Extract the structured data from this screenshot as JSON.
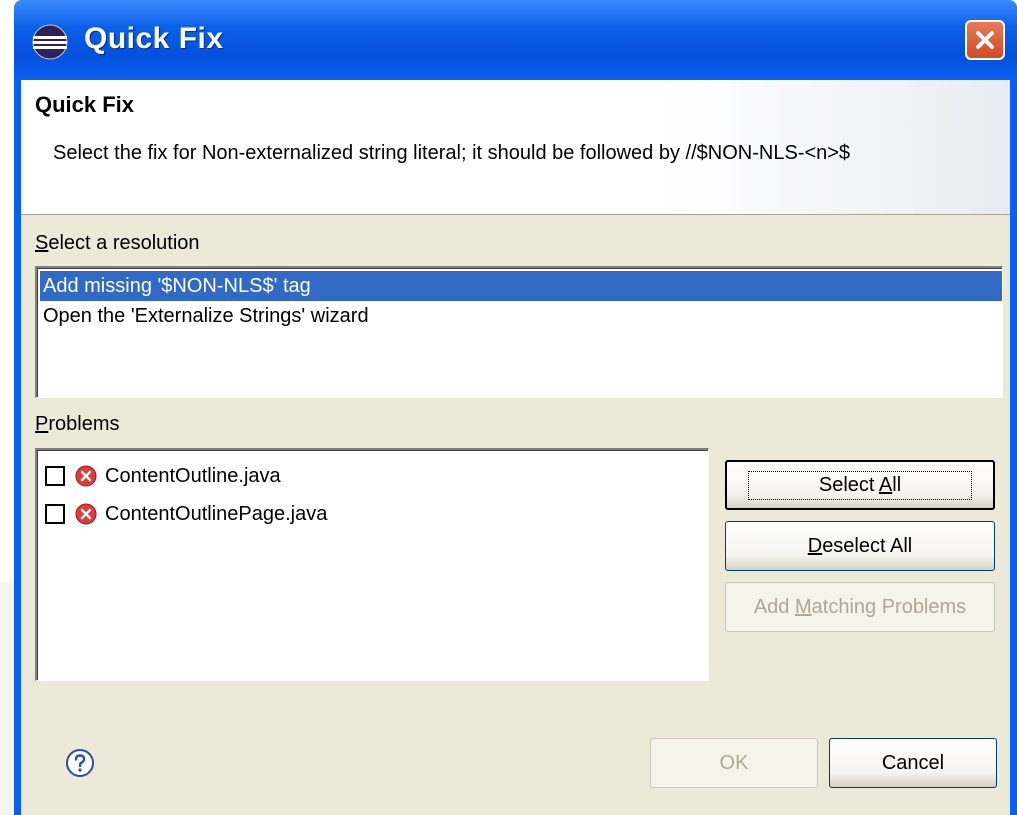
{
  "window": {
    "title": "Quick Fix"
  },
  "header": {
    "title": "Quick Fix",
    "message": "Select the fix for Non-externalized string literal; it should be followed by //$NON-NLS-<n>$"
  },
  "resolution": {
    "label_prefix": "S",
    "label_rest": "elect a resolution",
    "items": [
      {
        "label": "Add missing '$NON-NLS$' tag",
        "selected": true
      },
      {
        "label": "Open the 'Externalize Strings' wizard",
        "selected": false
      }
    ]
  },
  "problems": {
    "label_prefix": "P",
    "label_rest": "roblems",
    "items": [
      {
        "file": "ContentOutline.java",
        "checked": false,
        "icon": "error-icon"
      },
      {
        "file": "ContentOutlinePage.java",
        "checked": false,
        "icon": "error-icon"
      }
    ]
  },
  "buttons": {
    "select_all_pre": "Select ",
    "select_all_mn": "A",
    "select_all_post": "ll",
    "deselect_all_mn": "D",
    "deselect_all_post": "eselect All",
    "add_matching_pre": "Add ",
    "add_matching_mn": "M",
    "add_matching_post": "atching Problems",
    "ok": "OK",
    "cancel": "Cancel"
  },
  "colors": {
    "titlebar": "#0a5ef2",
    "selection": "#316ac5",
    "dialog_bg": "#ece9d8"
  }
}
